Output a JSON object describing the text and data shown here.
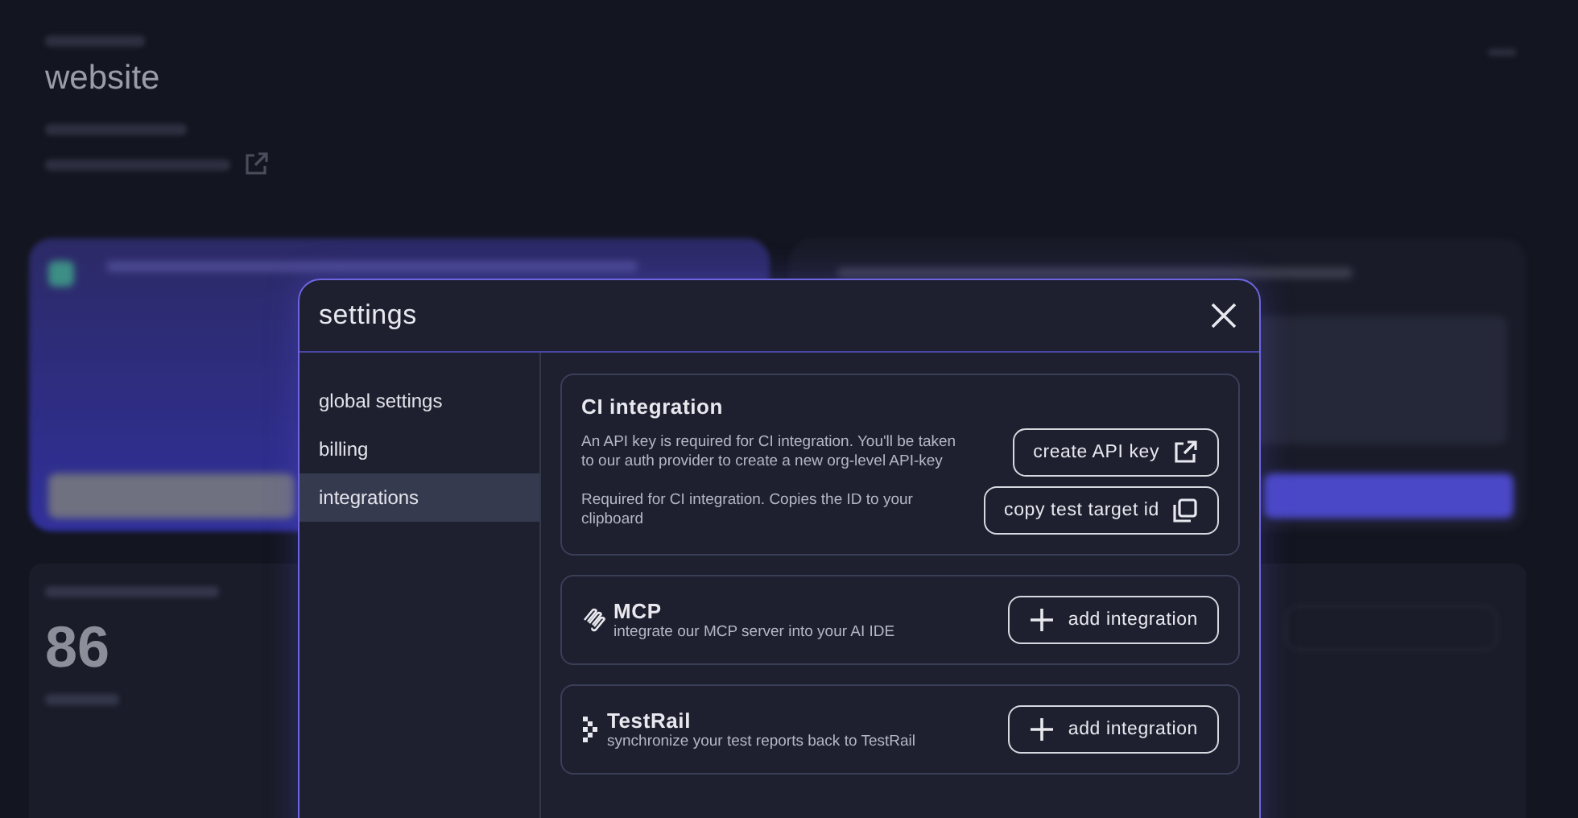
{
  "background": {
    "project_title": "website",
    "stat_value": "86"
  },
  "dialog": {
    "title": "settings",
    "sidebar": [
      {
        "label": "global settings",
        "selected": false
      },
      {
        "label": "billing",
        "selected": false
      },
      {
        "label": "integrations",
        "selected": true
      }
    ],
    "ci_integration": {
      "title": "CI integration",
      "actions": [
        {
          "description": "An API key is required for CI integration. You'll be taken to our auth provider to create a new org-level API-key",
          "button": "create API key",
          "kind": "external"
        },
        {
          "description": "Required for CI integration. Copies the ID to your clipboard",
          "button": "copy test target id",
          "kind": "copy"
        }
      ]
    },
    "integrations": [
      {
        "name": "MCP",
        "description": "integrate our MCP server into your AI IDE",
        "button": "add integration",
        "kind": "mcp"
      },
      {
        "name": "TestRail",
        "description": "synchronize your test reports back to TestRail",
        "button": "add integration",
        "kind": "testrail"
      }
    ]
  }
}
